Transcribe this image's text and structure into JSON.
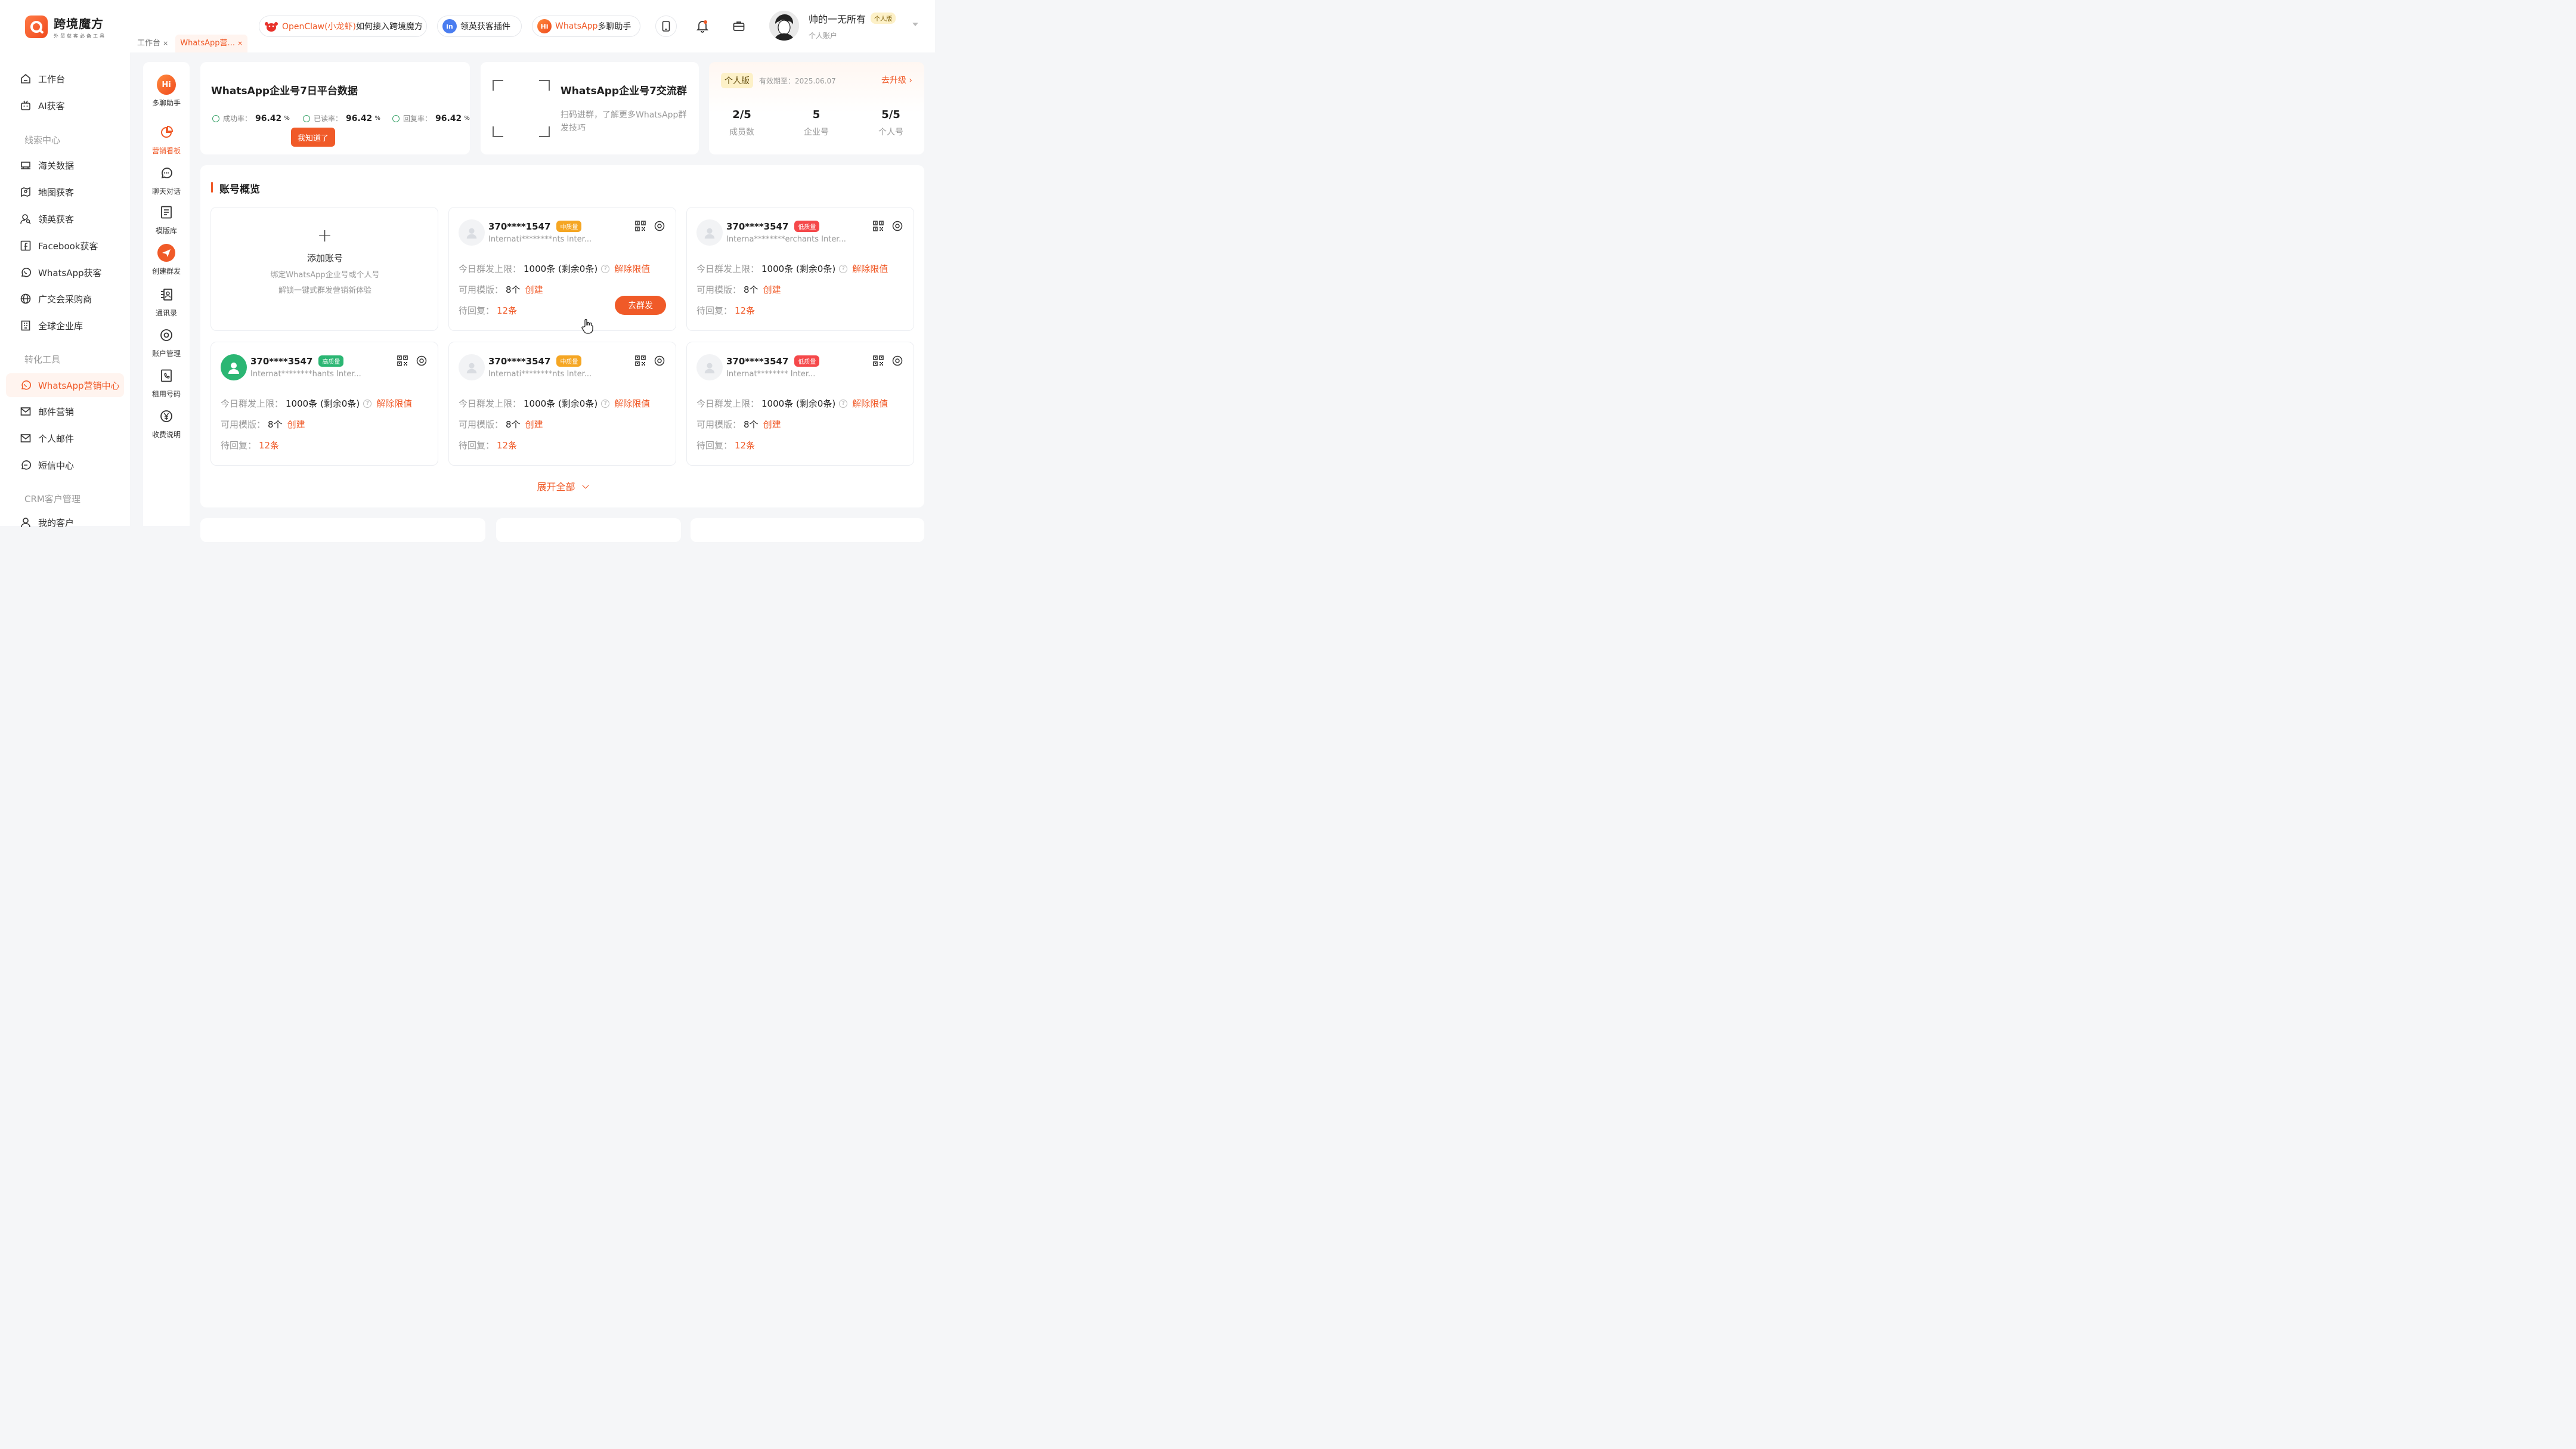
{
  "brand": {
    "title": "跨境魔方",
    "subtitle": "外贸获客必备工具"
  },
  "tabs": [
    {
      "label": "工作台",
      "close": "×"
    },
    {
      "label": "WhatsApp营...",
      "close": "×"
    }
  ],
  "header_pills": {
    "openclaw": {
      "highlight": "OpenClaw(小龙虾)",
      "rest": "如何接入跨境魔方"
    },
    "linkedin": {
      "icon": "in",
      "label": "领英获客插件"
    },
    "whatsapp": {
      "icon": "Hi",
      "highlight": "WhatsApp",
      "rest": "多聊助手"
    }
  },
  "user": {
    "name": "帅的一无所有",
    "badge": "个人版",
    "account_type": "个人账户"
  },
  "sidebar": {
    "items": [
      {
        "label": "工作台"
      },
      {
        "label": "AI获客"
      },
      {
        "label": "海关数据"
      },
      {
        "label": "地图获客"
      },
      {
        "label": "领英获客"
      },
      {
        "label": "Facebook获客"
      },
      {
        "label": "WhatsApp获客"
      },
      {
        "label": "广交会采购商"
      },
      {
        "label": "全球企业库"
      },
      {
        "label": "WhatsApp营销中心"
      },
      {
        "label": "邮件营销"
      },
      {
        "label": "个人邮件"
      },
      {
        "label": "短信中心"
      },
      {
        "label": "我的客户"
      }
    ],
    "sections": [
      "线索中心",
      "转化工具",
      "CRM客户管理"
    ]
  },
  "subnav": [
    {
      "label": "多聊助手"
    },
    {
      "label": "营销看板"
    },
    {
      "label": "聊天对话"
    },
    {
      "label": "模版库"
    },
    {
      "label": "创建群发"
    },
    {
      "label": "通讯录"
    },
    {
      "label": "账户管理"
    },
    {
      "label": "租用号码"
    },
    {
      "label": "收费说明"
    }
  ],
  "platform_card": {
    "title": "WhatsApp企业号7日平台数据",
    "metrics": [
      {
        "label": "成功率：",
        "value": "96.42",
        "unit": "%"
      },
      {
        "label": "已读率：",
        "value": "96.42",
        "unit": "%"
      },
      {
        "label": "回复率：",
        "value": "96.42",
        "unit": "%"
      }
    ],
    "ok_button": "我知道了"
  },
  "group_card": {
    "title": "WhatsApp企业号7交流群",
    "desc": "扫码进群，了解更多WhatsApp群发技巧"
  },
  "plan_card": {
    "badge": "个人版",
    "expiry": "有效期至：2025.06.07",
    "upgrade": "去升级",
    "stats": [
      {
        "value": "2/5",
        "label": "成员数"
      },
      {
        "value": "5",
        "label": "企业号"
      },
      {
        "value": "5/5",
        "label": "个人号"
      }
    ]
  },
  "overview": {
    "title": "账号概览",
    "add": {
      "title": "添加账号",
      "desc1": "绑定WhatsApp企业号或个人号",
      "desc2": "解锁一键式群发营销新体验"
    },
    "row_labels": {
      "limit": "今日群发上限：",
      "templates": "可用模版：",
      "pending": "待回复："
    },
    "accounts": [
      {
        "phone": "370****1547",
        "quality": "中质量",
        "qcolor": "#f5a623",
        "org": "Internati********nts Inter...",
        "limit": "1000条 (剩余0条)",
        "unlock": "解除限值",
        "templates": "8个",
        "create": "创建",
        "pending": "12条",
        "send": "去群发",
        "avatar": "gray"
      },
      {
        "phone": "370****3547",
        "quality": "低质量",
        "qcolor": "#f5484a",
        "org": "Interna********erchants Inter...",
        "limit": "1000条 (剩余0条)",
        "unlock": "解除限值",
        "templates": "8个",
        "create": "创建",
        "pending": "12条",
        "avatar": "gray"
      },
      {
        "phone": "370****3547",
        "quality": "高质量",
        "qcolor": "#2bb673",
        "org": "Internat********hants Inter...",
        "limit": "1000条 (剩余0条)",
        "unlock": "解除限值",
        "templates": "8个",
        "create": "创建",
        "pending": "12条",
        "avatar": "green"
      },
      {
        "phone": "370****3547",
        "quality": "中质量",
        "qcolor": "#f5a623",
        "org": "Internati********nts Inter...",
        "limit": "1000条 (剩余0条)",
        "unlock": "解除限值",
        "templates": "8个",
        "create": "创建",
        "pending": "12条",
        "avatar": "gray"
      },
      {
        "phone": "370****3547",
        "quality": "低质量",
        "qcolor": "#f5484a",
        "org": "Internat******** Inter...",
        "limit": "1000条 (剩余0条)",
        "unlock": "解除限值",
        "templates": "8个",
        "create": "创建",
        "pending": "12条",
        "avatar": "gray"
      }
    ],
    "expand": "展开全部"
  },
  "colors": {
    "accent": "#f05a28",
    "accent_bg": "#fff4ef"
  }
}
